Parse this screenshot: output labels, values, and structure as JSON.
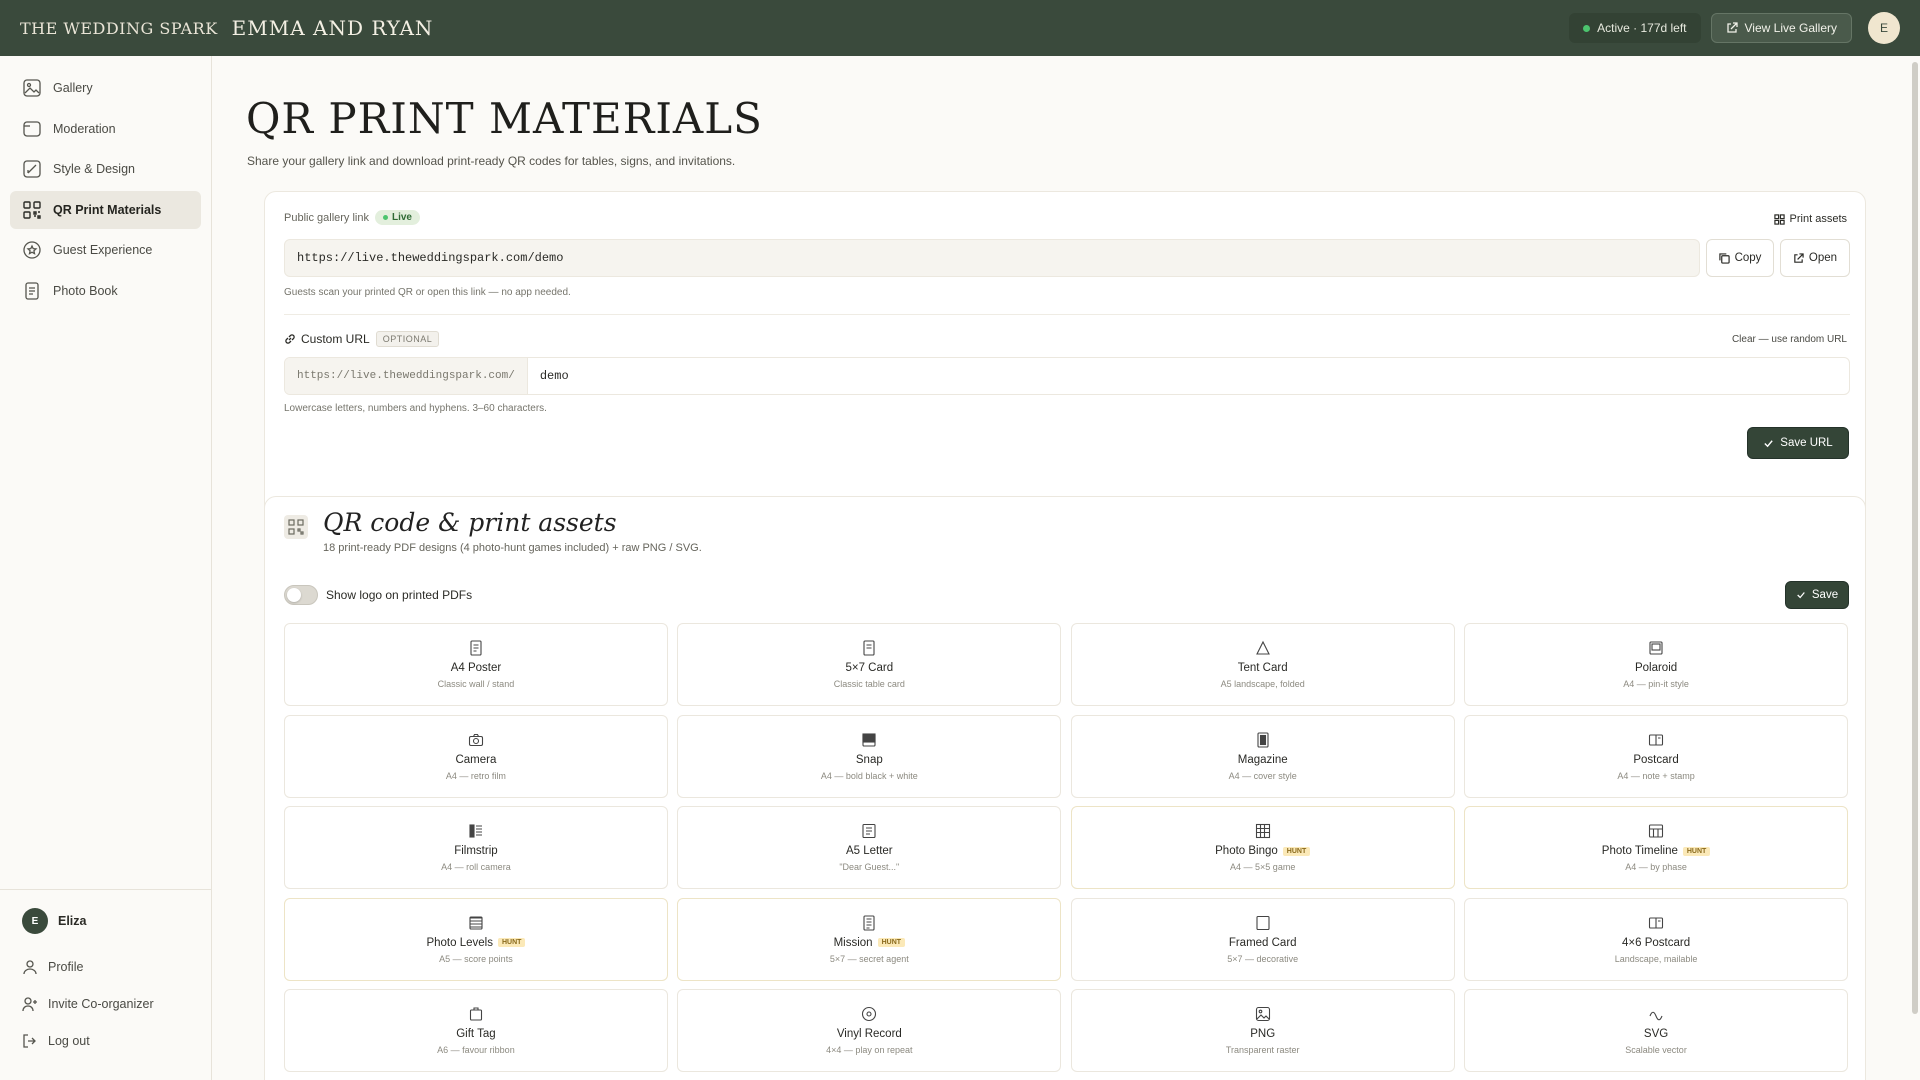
{
  "header": {
    "brand": "THE WEDDING SPARK",
    "couple": "EMMA AND RYAN",
    "status": "Active · 177d left",
    "view_live": "View Live Gallery",
    "avatar_initial": "E"
  },
  "sidebar": {
    "items": [
      {
        "label": "Gallery",
        "icon": "image-icon"
      },
      {
        "label": "Moderation",
        "icon": "folder-icon"
      },
      {
        "label": "Style & Design",
        "icon": "brush-icon"
      },
      {
        "label": "QR Print Materials",
        "icon": "qr-icon"
      },
      {
        "label": "Guest Experience",
        "icon": "star-icon"
      },
      {
        "label": "Photo Book",
        "icon": "book-icon"
      }
    ],
    "user": {
      "initial": "E",
      "name": "Eliza"
    },
    "bottom": [
      {
        "label": "Profile",
        "icon": "user-icon"
      },
      {
        "label": "Invite Co-organizer",
        "icon": "user-plus-icon"
      },
      {
        "label": "Log out",
        "icon": "logout-icon"
      }
    ]
  },
  "page": {
    "title": "QR PRINT MATERIALS",
    "subtitle": "Share your gallery link and download print-ready QR codes for tables, signs, and invitations."
  },
  "link_card": {
    "public_label": "Public gallery link",
    "live_badge": "Live",
    "print_assets": "Print assets",
    "url": "https://live.theweddingspark.com/demo",
    "copy": "Copy",
    "open": "Open",
    "hint": "Guests scan your printed QR or open this link — no app needed.",
    "custom_label": "Custom URL",
    "optional": "OPTIONAL",
    "clear": "Clear — use random URL",
    "prefix": "https://live.theweddingspark.com/",
    "slug": "demo",
    "slug_hint": "Lowercase letters, numbers and hyphens. 3–60 characters.",
    "save_url": "Save URL"
  },
  "assets": {
    "title": "QR code & print assets",
    "subtitle": "18 print-ready PDF designs (4 photo-hunt games included) + raw PNG / SVG.",
    "toggle_label": "Show logo on printed PDFs",
    "toggle_on": false,
    "save": "Save",
    "hunt_badge": "HUNT",
    "tiles": [
      {
        "name": "A4 Poster",
        "sub": "Classic wall / stand",
        "icon": "document-icon",
        "hunt": false
      },
      {
        "name": "5×7 Card",
        "sub": "Classic table card",
        "icon": "card-icon",
        "hunt": false
      },
      {
        "name": "Tent Card",
        "sub": "A5 landscape, folded",
        "icon": "triangle-icon",
        "hunt": false
      },
      {
        "name": "Polaroid",
        "sub": "A4 — pin-it style",
        "icon": "polaroid-icon",
        "hunt": false
      },
      {
        "name": "Camera",
        "sub": "A4 — retro film",
        "icon": "camera-icon",
        "hunt": false
      },
      {
        "name": "Snap",
        "sub": "A4 — bold black + white",
        "icon": "snap-icon",
        "hunt": false
      },
      {
        "name": "Magazine",
        "sub": "A4 — cover style",
        "icon": "magazine-icon",
        "hunt": false
      },
      {
        "name": "Postcard",
        "sub": "A4 — note + stamp",
        "icon": "postcard-icon",
        "hunt": false
      },
      {
        "name": "Filmstrip",
        "sub": "A4 — roll camera",
        "icon": "filmstrip-icon",
        "hunt": false
      },
      {
        "name": "A5 Letter",
        "sub": "\"Dear Guest...\"",
        "icon": "letter-icon",
        "hunt": false
      },
      {
        "name": "Photo Bingo",
        "sub": "A4 — 5×5 game",
        "icon": "grid-icon",
        "hunt": true
      },
      {
        "name": "Photo Timeline",
        "sub": "A4 — by phase",
        "icon": "timeline-icon",
        "hunt": true
      },
      {
        "name": "Photo Levels",
        "sub": "A5 — score points",
        "icon": "levels-icon",
        "hunt": true
      },
      {
        "name": "Mission",
        "sub": "5×7 — secret agent",
        "icon": "mission-icon",
        "hunt": true
      },
      {
        "name": "Framed Card",
        "sub": "5×7 — decorative",
        "icon": "frame-icon",
        "hunt": false
      },
      {
        "name": "4×6 Postcard",
        "sub": "Landscape, mailable",
        "icon": "postcard-icon",
        "hunt": false
      },
      {
        "name": "Gift Tag",
        "sub": "A6 — favour ribbon",
        "icon": "tag-icon",
        "hunt": false
      },
      {
        "name": "Vinyl Record",
        "sub": "4×4 — play on repeat",
        "icon": "vinyl-icon",
        "hunt": false
      },
      {
        "name": "PNG",
        "sub": "Transparent raster",
        "icon": "png-icon",
        "hunt": false
      },
      {
        "name": "SVG",
        "sub": "Scalable vector",
        "icon": "svg-icon",
        "hunt": false
      }
    ]
  },
  "colors": {
    "topbar": "#3a4a3c",
    "accent": "#344537",
    "live_dot": "#4cc46e",
    "hunt_badge": "#fbe9b8"
  }
}
